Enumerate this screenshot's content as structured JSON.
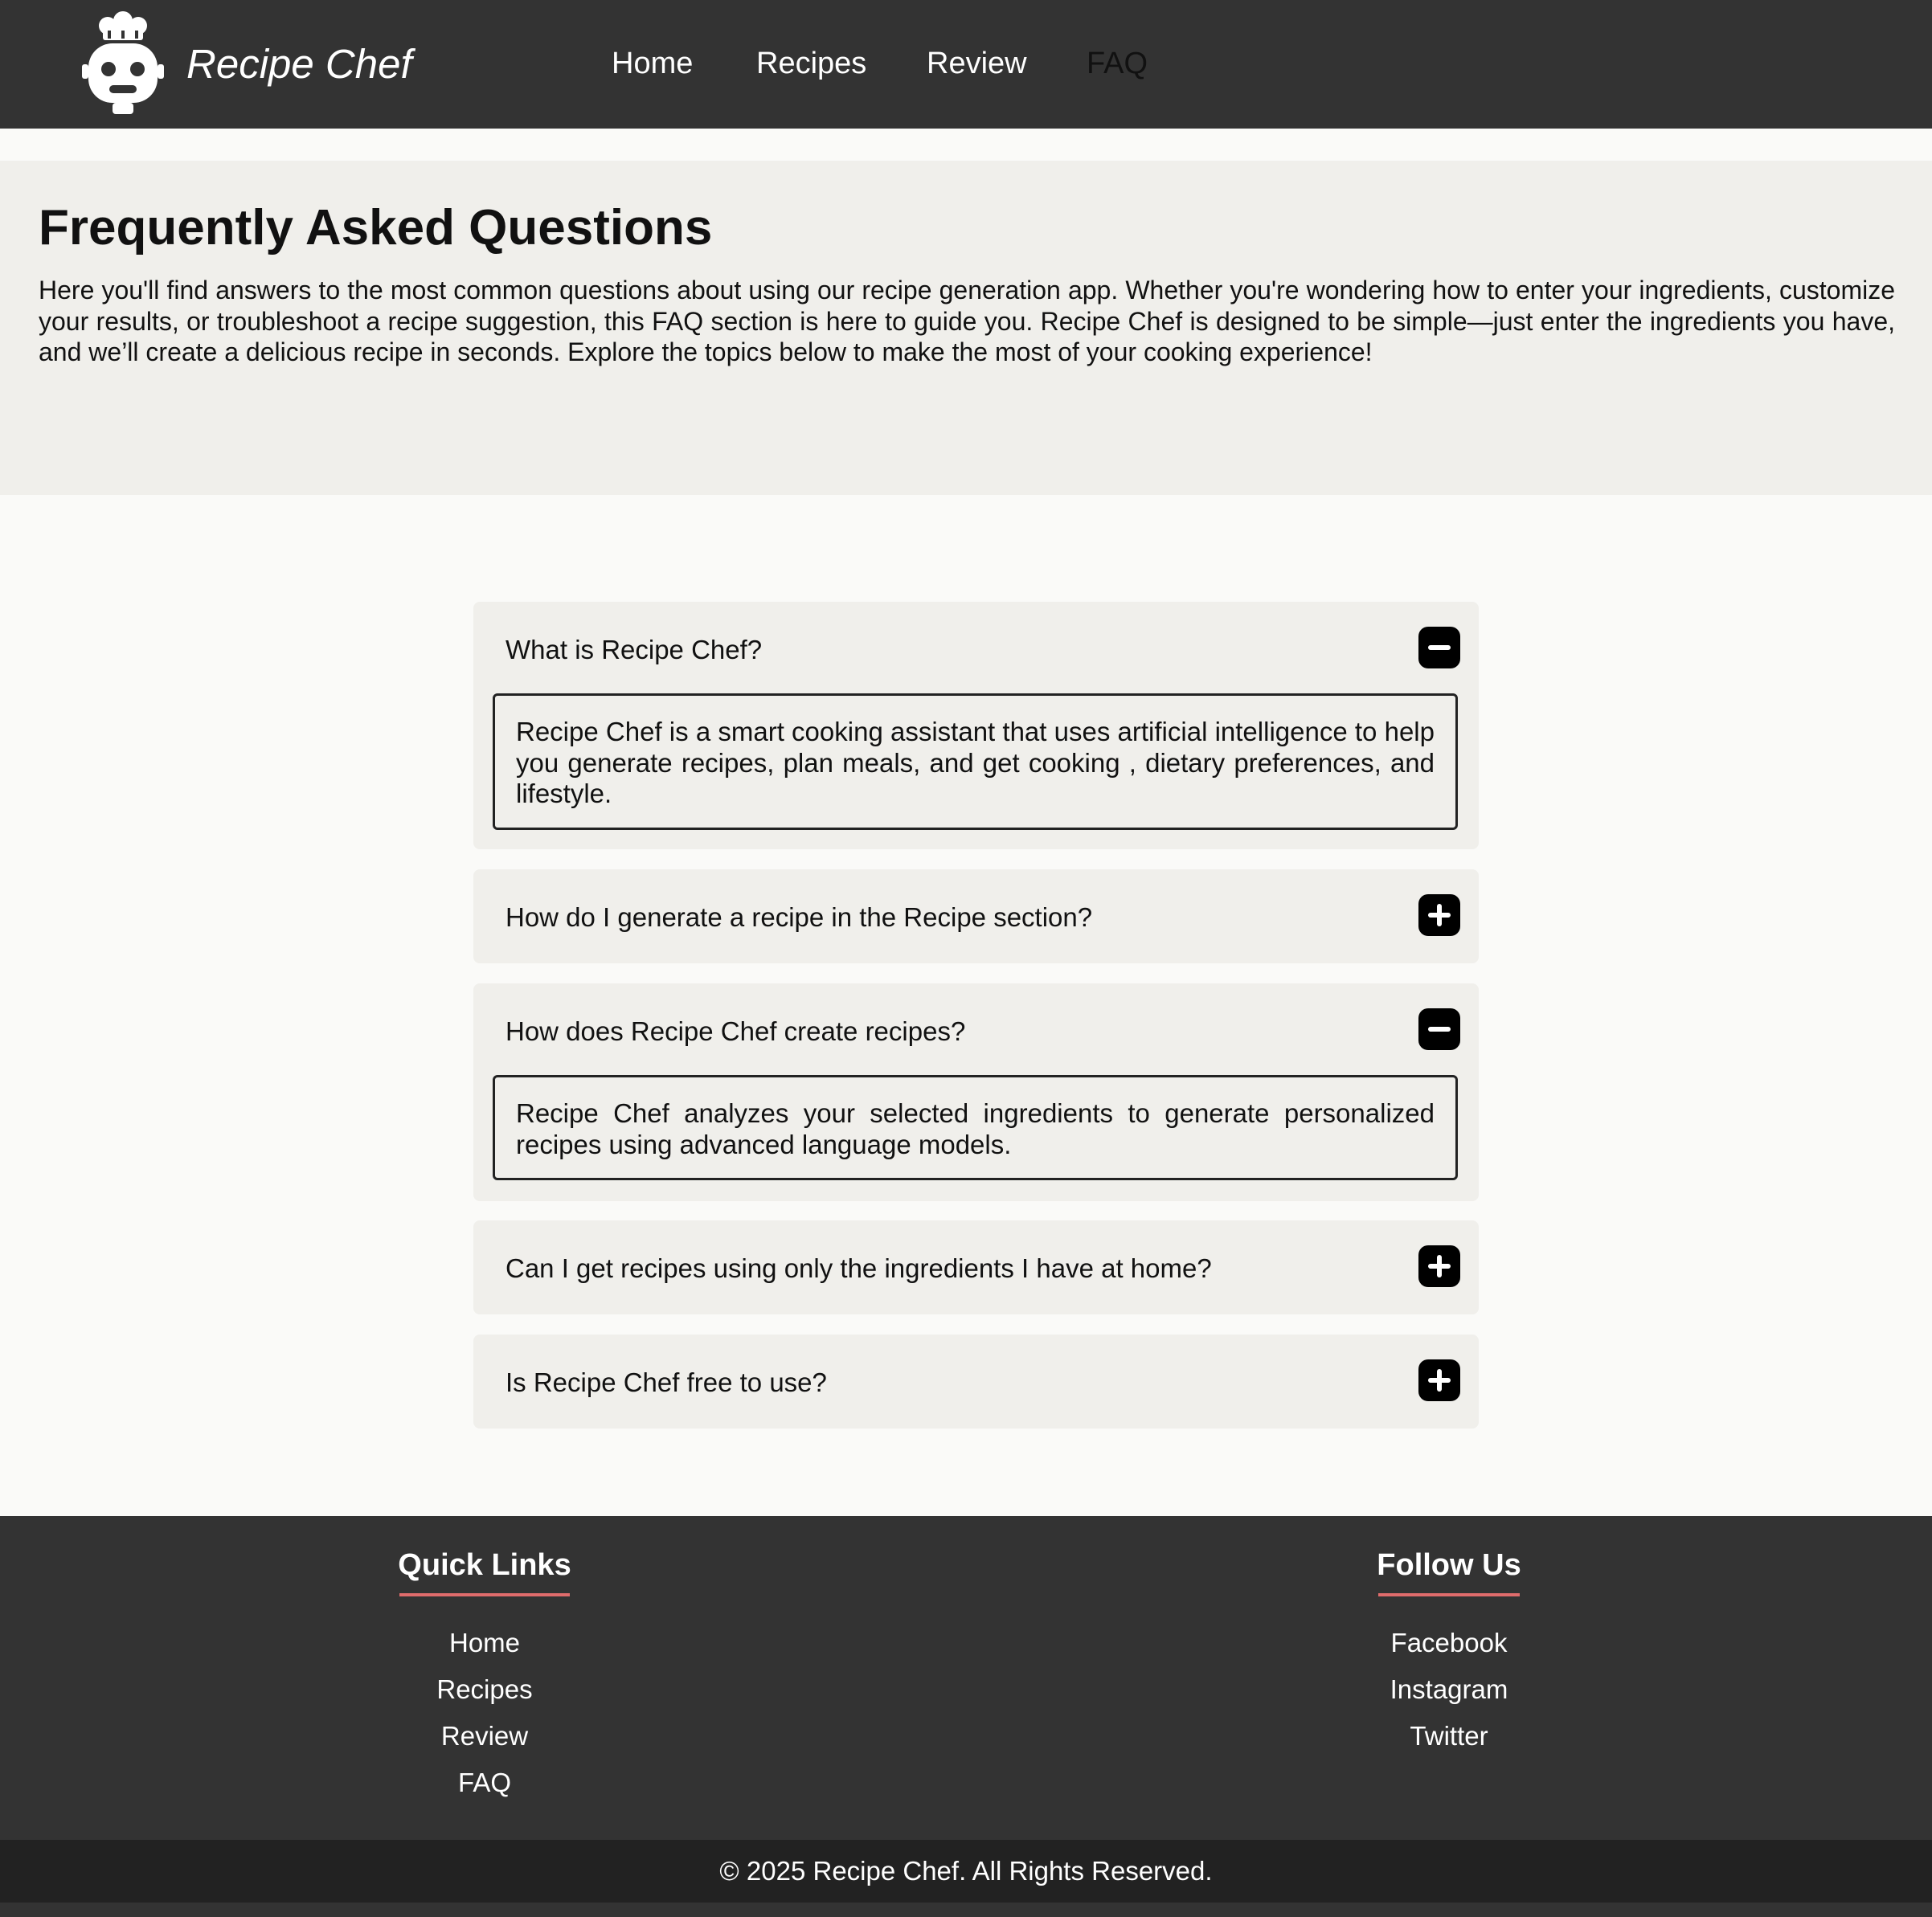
{
  "header": {
    "brand": "Recipe Chef",
    "logo_icon": "chef-robot-icon",
    "nav": [
      {
        "label": "Home",
        "active": false
      },
      {
        "label": "Recipes",
        "active": false
      },
      {
        "label": "Review",
        "active": false
      },
      {
        "label": "FAQ",
        "active": true
      }
    ]
  },
  "intro": {
    "title": "Frequently Asked Questions",
    "text": "Here you'll find answers to the most common questions about using our recipe generation app. Whether you're wondering how to enter your ingredients, customize your results, or troubleshoot a recipe suggestion, this FAQ section is here to guide you. Recipe Chef is designed to be simple—just enter the ingredients you have, and we’ll create a delicious recipe in seconds. Explore the topics below to make the most of your cooking experience!"
  },
  "faq": [
    {
      "question": "What is Recipe Chef?",
      "expanded": true,
      "toggle_icon": "minus-icon",
      "answer": "Recipe Chef is a smart cooking assistant that uses artificial intelligence to help you generate recipes, plan meals, and get cooking , dietary preferences, and lifestyle."
    },
    {
      "question": "How do I generate a recipe in the Recipe section?",
      "expanded": false,
      "toggle_icon": "plus-icon"
    },
    {
      "question": "How does Recipe Chef create recipes?",
      "expanded": true,
      "toggle_icon": "minus-icon",
      "answer": "Recipe Chef analyzes your selected ingredients to generate personalized recipes using advanced language models."
    },
    {
      "question": "Can I get recipes using only the ingredients I have at home?",
      "expanded": false,
      "toggle_icon": "plus-icon"
    },
    {
      "question": "Is Recipe Chef free to use?",
      "expanded": false,
      "toggle_icon": "plus-icon"
    }
  ],
  "footer": {
    "quick_links": {
      "title": "Quick Links",
      "links": [
        "Home",
        "Recipes",
        "Review",
        "FAQ"
      ]
    },
    "follow_us": {
      "title": "Follow Us",
      "links": [
        "Facebook",
        "Instagram",
        "Twitter"
      ]
    },
    "copyright": "© 2025 Recipe Chef. All Rights Reserved.",
    "accent_color": "#e06c6c"
  },
  "colors": {
    "header_bg": "#333333",
    "page_bg": "#fafaf8",
    "card_bg": "#f0efeb"
  }
}
